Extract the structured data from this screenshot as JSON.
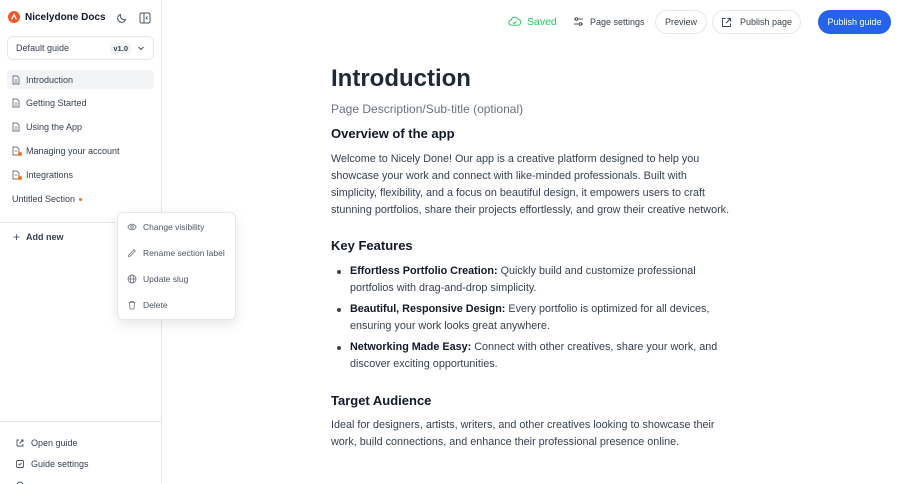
{
  "app": {
    "name": "Nicelydone Docs"
  },
  "guide_select": {
    "value": "Default guide",
    "version": "v1.0"
  },
  "nav": {
    "items": [
      {
        "label": "Introduction"
      },
      {
        "label": "Getting Started"
      },
      {
        "label": "Using the App"
      },
      {
        "label": "Managing your account"
      },
      {
        "label": "Integrations"
      }
    ],
    "section_label": "Untitled Section",
    "add_new": "Add new"
  },
  "context_menu": {
    "items": [
      "Change visibility",
      "Rename section label",
      "Update slug",
      "Delete"
    ]
  },
  "sidebar_bottom": {
    "open_guide": "Open guide",
    "guide_settings": "Guide settings"
  },
  "toolbar": {
    "saved": "Saved",
    "page_settings": "Page settings",
    "preview": "Preview",
    "publish_page": "Publish page",
    "publish_guide": "Publish guide"
  },
  "doc": {
    "title": "Introduction",
    "description": "Page Description/Sub-title (optional)",
    "overview_heading": "Overview of the app",
    "overview_text": "Welcome to Nicely Done! Our app is a creative platform designed to help you showcase your work and connect with like-minded professionals. Built with simplicity, flexibility, and a focus on beautiful design, it empowers users to craft stunning portfolios, share their projects effortlessly, and grow their creative network.",
    "features_heading": "Key Features",
    "features": [
      {
        "title": "Effortless Portfolio Creation:",
        "text": " Quickly build and customize professional portfolios with drag-and-drop simplicity."
      },
      {
        "title": "Beautiful, Responsive Design:",
        "text": " Every portfolio is optimized for all devices, ensuring your work looks great anywhere."
      },
      {
        "title": "Networking Made Easy:",
        "text": " Connect with other creatives, share your work, and discover exciting opportunities."
      }
    ],
    "audience_heading": "Target Audience",
    "audience_text": "Ideal for designers, artists, writers, and other creatives looking to showcase their work, build connections, and enhance their professional presence online."
  },
  "colors": {
    "accent": "#2563eb",
    "brand": "#f05a28",
    "saved": "#22c55e",
    "unpublished_dot": "#f97316"
  }
}
